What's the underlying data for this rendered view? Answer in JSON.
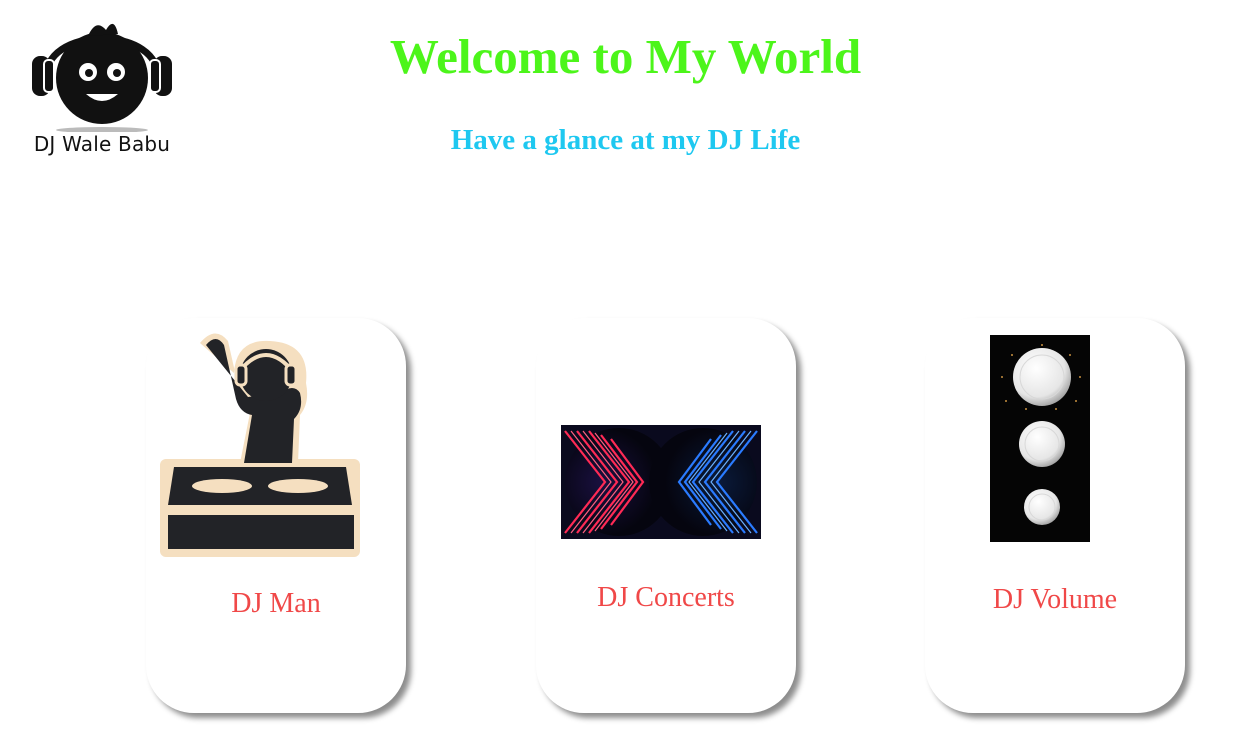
{
  "header": {
    "logo_text": "DJ Wale Babu",
    "title": "Welcome to My World",
    "subtitle": "Have a glance at my DJ Life"
  },
  "cards": [
    {
      "label": "DJ Man",
      "icon": "dj-man-icon"
    },
    {
      "label": "DJ Concerts",
      "icon": "neon-chevrons-image"
    },
    {
      "label": "DJ Volume",
      "icon": "volume-knobs-image"
    }
  ],
  "colors": {
    "title": "#4cf51a",
    "subtitle": "#1ec8f0",
    "card_label": "#f04848",
    "background": "#ffffff"
  }
}
